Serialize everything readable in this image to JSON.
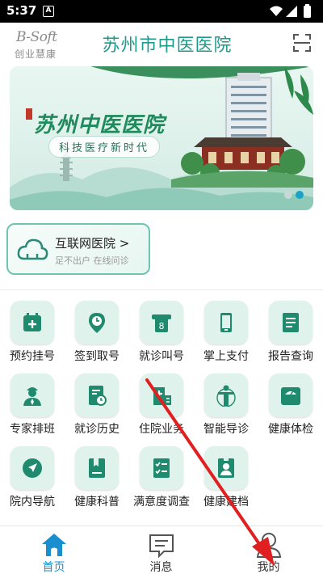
{
  "status_bar": {
    "time": "5:37",
    "notification_glyph": "A"
  },
  "header": {
    "logo_top": "B-Soft",
    "logo_bottom": "创业慧康",
    "title": "苏州市中医医院",
    "scan_icon": "scan-icon"
  },
  "banner": {
    "title": "苏州中医医院",
    "subtitle": "科技医疗新时代",
    "slide_count": 2,
    "active_slide": 2
  },
  "internet_hospital": {
    "title": "互联网医院",
    "chevron": ">",
    "subtitle": "足不出户 在线问诊"
  },
  "grid": [
    {
      "label": "预约挂号",
      "icon": "calendar-plus-icon"
    },
    {
      "label": "签到取号",
      "icon": "location-clock-icon"
    },
    {
      "label": "就诊叫号",
      "icon": "ticket-number-icon"
    },
    {
      "label": "掌上支付",
      "icon": "phone-icon"
    },
    {
      "label": "报告查询",
      "icon": "report-icon"
    },
    {
      "label": "专家排班",
      "icon": "doctor-icon"
    },
    {
      "label": "就诊历史",
      "icon": "history-doc-icon"
    },
    {
      "label": "住院业务",
      "icon": "hospital-bed-icon"
    },
    {
      "label": "智能导诊",
      "icon": "body-guide-icon"
    },
    {
      "label": "健康体检",
      "icon": "scale-icon"
    },
    {
      "label": "院内导航",
      "icon": "navigation-icon"
    },
    {
      "label": "健康科普",
      "icon": "book-icon"
    },
    {
      "label": "满意度调查",
      "icon": "checklist-icon"
    },
    {
      "label": "健康建档",
      "icon": "profile-card-icon"
    }
  ],
  "bottom_nav": [
    {
      "label": "首页",
      "icon": "home-icon",
      "active": true
    },
    {
      "label": "消息",
      "icon": "message-icon",
      "active": false
    },
    {
      "label": "我的",
      "icon": "user-icon",
      "active": false
    }
  ],
  "colors": {
    "accent": "#1e9a8a",
    "icon_bg": "#dff2ec",
    "icon_fg": "#1f8a6e",
    "nav_active": "#1a8fd0",
    "annotation": "#e02020"
  }
}
